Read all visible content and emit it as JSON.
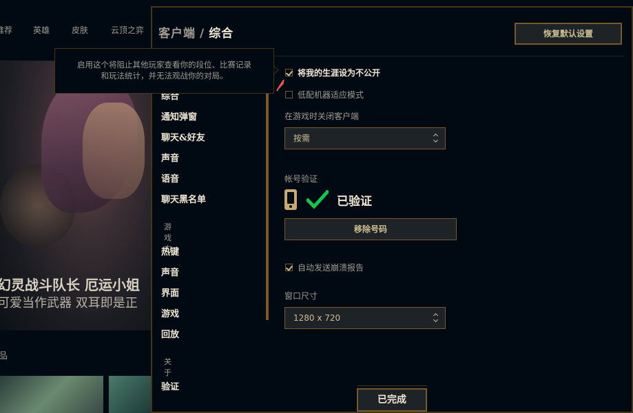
{
  "background": {
    "nav_items": [
      "推荐",
      "英雄",
      "皮肤",
      "云顶之弈"
    ],
    "splash_title": "幻灵战斗队长 厄运小姐",
    "splash_subtitle": "可爱当作武器 双耳即是正",
    "bottom_label": "品"
  },
  "modal": {
    "title_section": "客户端",
    "title_separator": "/",
    "title_current": "综合",
    "reset_button": "恢复默认设置",
    "done_button": "已完成"
  },
  "sidebar": {
    "items_top": [
      "综合",
      "通知弹窗",
      "聊天&好友",
      "声音",
      "语音",
      "聊天黑名单"
    ],
    "section_ingame": "游戏内",
    "items_ingame": [
      "热键",
      "声音",
      "界面",
      "游戏",
      "回放"
    ],
    "section_about": "关于",
    "items_about": [
      "验证"
    ]
  },
  "settings": {
    "private_career": {
      "label": "将我的生涯设为不公开",
      "checked": true
    },
    "low_spec": {
      "label": "低配机器适应模式",
      "checked": false
    },
    "close_client_label": "在游戏时关闭客户端",
    "close_client_value": "按需",
    "account_verify_label": "帐号验证",
    "verified_text": "已验证",
    "remove_number_button": "移除号码",
    "auto_crash_report": {
      "label": "自动发送崩溃报告",
      "checked": true
    },
    "window_size_label": "窗口尺寸",
    "window_size_value": "1280 x 720"
  },
  "tooltip": {
    "text_line1": "启用这个将阻止其他玩家查看你的段位、比赛记录",
    "text_line2": "和玩法统计，并无法观战你的对局。"
  },
  "colors": {
    "gold_border": "#785a28",
    "gold_text": "#cdbe91",
    "bright_text": "#f0e6d2",
    "muted_text": "#a09b8c",
    "check_green": "#0acb4b"
  }
}
